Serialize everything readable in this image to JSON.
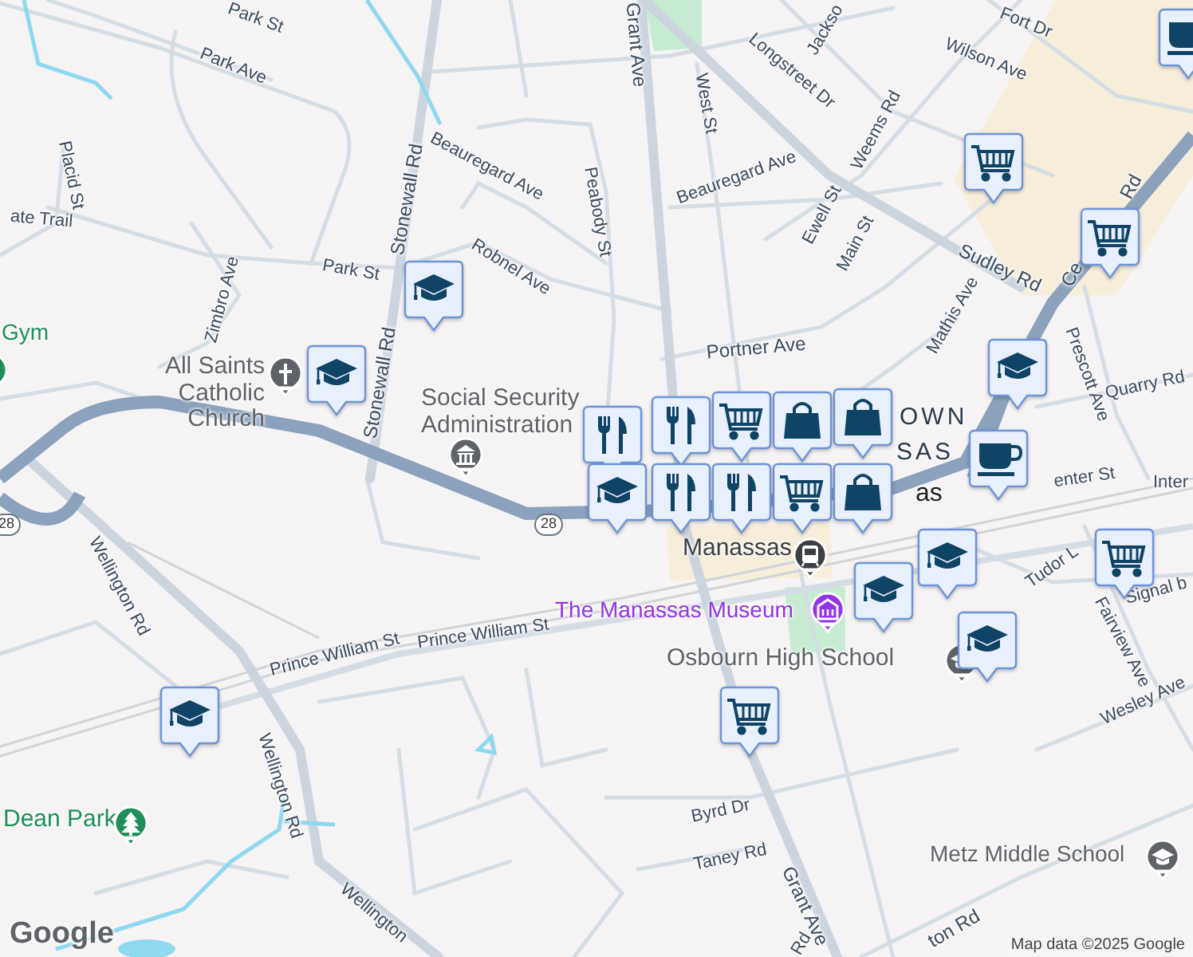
{
  "map": {
    "street_labels": [
      "Park St",
      "Park Ave",
      "Placid St",
      "ate Trail",
      "Zimbro Ave",
      "Park St",
      "Stonewall Rd",
      "Stonewall Rd",
      "Beauregard Ave",
      "Robnel Ave",
      "Peabody St",
      "Grant Ave",
      "West St",
      "Longstreet Dr",
      "Jackso",
      "Fort Dr",
      "Wilson Ave",
      "Weems Rd",
      "Beauregard Ave",
      "Ewell St",
      "Main St",
      "Sudley Rd",
      "Mathis Ave",
      "Portner Ave",
      "Prescott Ave",
      "Quarry Rd",
      "Ce",
      "Rd",
      "enter St",
      "Inter",
      "Wellington Rd",
      "Wellington Rd",
      "Wellington",
      "Prince William St",
      "Prince William St",
      "Tudor L",
      "Fairview Ave",
      "Signal b",
      "Wesley Ave",
      "Byrd Dr",
      "Taney Rd",
      "Grant Ave",
      "ton Rd",
      "Rd"
    ],
    "route_shields": [
      "28",
      "28"
    ],
    "places": [
      {
        "name": "Gym",
        "kind": "recreation"
      },
      {
        "name": "All Saints Catholic Church",
        "kind": "church"
      },
      {
        "name": "Social Security Administration",
        "kind": "government"
      },
      {
        "name": "OWN",
        "kind": "district"
      },
      {
        "name": "SAS",
        "kind": "district"
      },
      {
        "name": "as",
        "kind": "city"
      },
      {
        "name": "Manassas",
        "kind": "transit"
      },
      {
        "name": "The Manassas Museum",
        "kind": "museum"
      },
      {
        "name": "Osbourn High School",
        "kind": "school"
      },
      {
        "name": "Metz Middle School",
        "kind": "school"
      },
      {
        "name": "Dean Park",
        "kind": "park"
      }
    ],
    "markers": [
      {
        "kind": "school"
      },
      {
        "kind": "school"
      },
      {
        "kind": "shopping"
      },
      {
        "kind": "shopping"
      },
      {
        "kind": "cafe"
      },
      {
        "kind": "restaurant"
      },
      {
        "kind": "bag"
      },
      {
        "kind": "school"
      },
      {
        "kind": "cafe"
      },
      {
        "kind": "shopping"
      },
      {
        "kind": "restaurant"
      },
      {
        "kind": "bag"
      },
      {
        "kind": "restaurant"
      },
      {
        "kind": "bag"
      },
      {
        "kind": "shopping"
      },
      {
        "kind": "restaurant"
      },
      {
        "kind": "school"
      },
      {
        "kind": "school"
      },
      {
        "kind": "school"
      },
      {
        "kind": "shopping"
      },
      {
        "kind": "school"
      },
      {
        "kind": "shopping"
      },
      {
        "kind": "school"
      }
    ]
  },
  "branding": {
    "logo": "Google",
    "attribution": "Map data ©2025 Google"
  }
}
